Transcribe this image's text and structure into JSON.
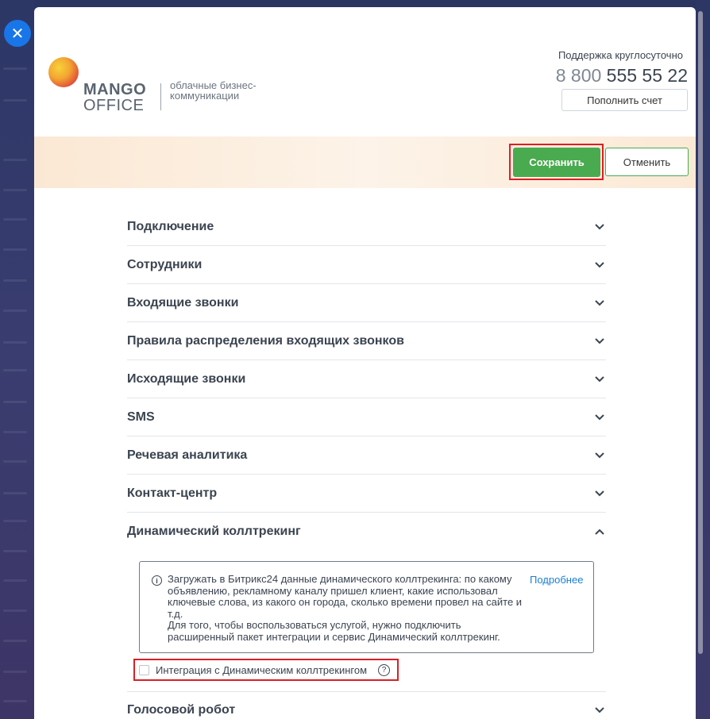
{
  "close": {
    "icon": "close-icon",
    "glyph": "✕"
  },
  "header": {
    "logo": {
      "word1": "MANGO",
      "word2": "OFFICE",
      "tagline": "облачные бизнес-коммуникации"
    },
    "support_label": "Поддержка круглосуточно",
    "phone_prefix": "8 800",
    "phone_number": "555 55 22",
    "topup_label": "Пополнить счет"
  },
  "actions": {
    "save_label": "Сохранить",
    "cancel_label": "Отменить"
  },
  "sections": [
    {
      "label": "Подключение"
    },
    {
      "label": "Сотрудники"
    },
    {
      "label": "Входящие звонки"
    },
    {
      "label": "Правила распределения входящих звонков"
    },
    {
      "label": "Исходящие звонки"
    },
    {
      "label": "SMS"
    },
    {
      "label": "Речевая аналитика"
    },
    {
      "label": "Контакт-центр"
    },
    {
      "label": "Динамический коллтрекинг"
    },
    {
      "label": "Голосовой робот"
    }
  ],
  "calltracking": {
    "info_text_1": "Загружать в Битрикс24 данные динамического коллтрекинга: по какому объявлению, рекламному каналу пришел клиент, какие использовал ключевые слова, из какого он города, сколько времени провел на сайте и т.д.",
    "info_text_2": "Для того, чтобы воспользоваться услугой, нужно подключить расширенный пакет интеграции и сервис Динамический коллтрекинг.",
    "more_link": "Подробнее",
    "checkbox_label": "Интеграция с Динамическим коллтрекингом",
    "checkbox_checked": false,
    "help_glyph": "?"
  },
  "colors": {
    "accent_green": "#4aaa4f",
    "highlight_red": "#d91f26",
    "link_blue": "#1a7fd4",
    "close_blue": "#1976e8"
  }
}
